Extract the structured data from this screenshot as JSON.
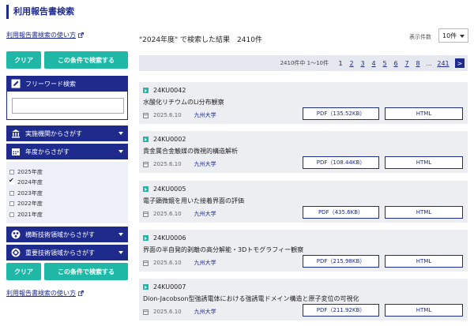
{
  "page_title": "利用報告書検索",
  "help_link": "利用報告書検索の使い方",
  "buttons": {
    "clear": "クリア",
    "search": "この条件で検索する"
  },
  "sidebar": {
    "free_word": {
      "label": "フリーワード検索",
      "value": ""
    },
    "institution": {
      "label": "実施機関からさがす"
    },
    "year": {
      "label": "年度からさがす",
      "options": [
        {
          "label": "2025年度",
          "checked": false
        },
        {
          "label": "2024年度",
          "checked": true
        },
        {
          "label": "2023年度",
          "checked": false
        },
        {
          "label": "2022年度",
          "checked": false
        },
        {
          "label": "2021年度",
          "checked": false
        }
      ]
    },
    "cross_tech": {
      "label": "横断技術領域からさがす"
    },
    "key_tech": {
      "label": "重要技術領域からさがす"
    }
  },
  "results": {
    "title": "\"2024年度\" で検索した結果　2410件",
    "per_page_label": "表示件数",
    "per_page_value": "10件",
    "range_text": "2410件中 1〜10件",
    "pages": [
      "1",
      "2",
      "3",
      "4",
      "5",
      "6",
      "7",
      "8"
    ],
    "current_page": "1",
    "ellipsis": "...",
    "last_page": "241",
    "next_symbol": ">",
    "items": [
      {
        "id": "24KU0042",
        "title": "水酸化リチウムのLi分布観察",
        "date": "2025.6.10",
        "institution": "九州大学",
        "pdf": "PDF（135.52KB）",
        "html": "HTML"
      },
      {
        "id": "24KU0002",
        "title": "貴金属合金触媒の微視的構造解析",
        "date": "2025.6.10",
        "institution": "九州大学",
        "pdf": "PDF（108.44KB）",
        "html": "HTML"
      },
      {
        "id": "24KU0005",
        "title": "電子顕微鏡を用いた接着界面の評価",
        "date": "2025.6.10",
        "institution": "九州大学",
        "pdf": "PDF（435.6KB）",
        "html": "HTML"
      },
      {
        "id": "24KU0006",
        "title": "界面の半自発的剥離の高分解能・3Dトモグラフィー観察",
        "date": "2025.6.10",
        "institution": "九州大学",
        "pdf": "PDF（215.98KB）",
        "html": "HTML"
      },
      {
        "id": "24KU0007",
        "title": "Dion-Jacobson型強誘電体における強誘電ドメイン構造と原子変位の可視化",
        "date": "2025.6.10",
        "institution": "九州大学",
        "pdf": "PDF（211.92KB）",
        "html": "HTML"
      }
    ]
  },
  "colors": {
    "navy": "#1e2a8c",
    "teal": "#1fb8a6",
    "panel": "#eef0f8",
    "card": "#edeef2"
  }
}
